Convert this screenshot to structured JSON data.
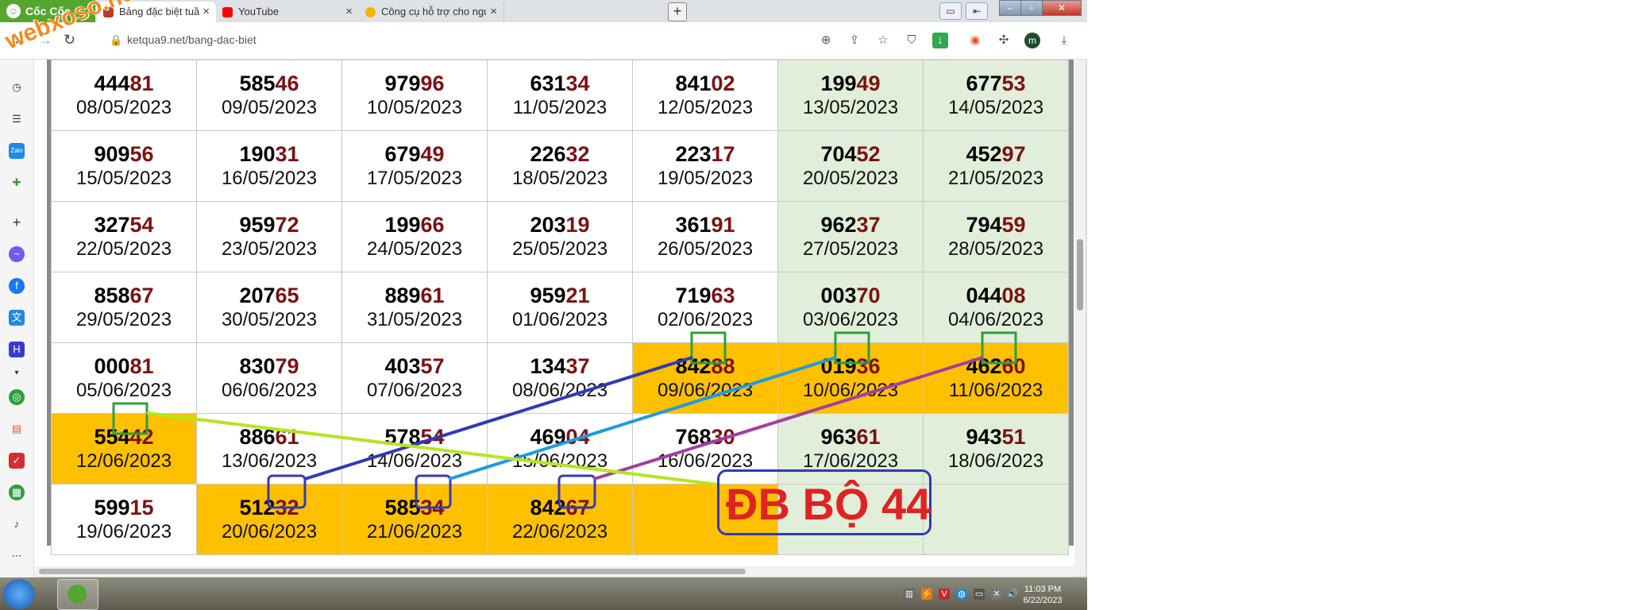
{
  "browser": {
    "brand": "Cốc Cốc",
    "tabs": [
      {
        "title": "Bảng đặc biệt tuần Xổ Số Tru",
        "favicon_color": "#c0392b",
        "active": true
      },
      {
        "title": "YouTube",
        "favicon_color": "#ff0000",
        "active": false
      },
      {
        "title": "Công cụ hỗ trợ cho người ch",
        "favicon_color": "#f4b400",
        "active": false
      }
    ],
    "url": "ketqua9.net/bang-dac-biet",
    "profile_initial": "m"
  },
  "watermark": "webxoso.net",
  "table": {
    "rows": [
      [
        {
          "pre": "444",
          "hi": "81",
          "date": "08/05/2023",
          "bg": "white"
        },
        {
          "pre": "585",
          "hi": "46",
          "date": "09/05/2023",
          "bg": "white"
        },
        {
          "pre": "979",
          "hi": "96",
          "date": "10/05/2023",
          "bg": "white"
        },
        {
          "pre": "631",
          "hi": "34",
          "date": "11/05/2023",
          "bg": "white"
        },
        {
          "pre": "841",
          "hi": "02",
          "date": "12/05/2023",
          "bg": "white"
        },
        {
          "pre": "199",
          "hi": "49",
          "date": "13/05/2023",
          "bg": "weekend"
        },
        {
          "pre": "677",
          "hi": "53",
          "date": "14/05/2023",
          "bg": "weekend"
        }
      ],
      [
        {
          "pre": "909",
          "hi": "56",
          "date": "15/05/2023",
          "bg": "white"
        },
        {
          "pre": "190",
          "hi": "31",
          "date": "16/05/2023",
          "bg": "white"
        },
        {
          "pre": "679",
          "hi": "49",
          "date": "17/05/2023",
          "bg": "white"
        },
        {
          "pre": "226",
          "hi": "32",
          "date": "18/05/2023",
          "bg": "white"
        },
        {
          "pre": "223",
          "hi": "17",
          "date": "19/05/2023",
          "bg": "white"
        },
        {
          "pre": "704",
          "hi": "52",
          "date": "20/05/2023",
          "bg": "weekend"
        },
        {
          "pre": "452",
          "hi": "97",
          "date": "21/05/2023",
          "bg": "weekend"
        }
      ],
      [
        {
          "pre": "327",
          "hi": "54",
          "date": "22/05/2023",
          "bg": "white"
        },
        {
          "pre": "959",
          "hi": "72",
          "date": "23/05/2023",
          "bg": "white"
        },
        {
          "pre": "199",
          "hi": "66",
          "date": "24/05/2023",
          "bg": "white"
        },
        {
          "pre": "203",
          "hi": "19",
          "date": "25/05/2023",
          "bg": "white"
        },
        {
          "pre": "361",
          "hi": "91",
          "date": "26/05/2023",
          "bg": "white"
        },
        {
          "pre": "962",
          "hi": "37",
          "date": "27/05/2023",
          "bg": "weekend"
        },
        {
          "pre": "794",
          "hi": "59",
          "date": "28/05/2023",
          "bg": "weekend"
        }
      ],
      [
        {
          "pre": "858",
          "hi": "67",
          "date": "29/05/2023",
          "bg": "white"
        },
        {
          "pre": "207",
          "hi": "65",
          "date": "30/05/2023",
          "bg": "white"
        },
        {
          "pre": "889",
          "hi": "61",
          "date": "31/05/2023",
          "bg": "white"
        },
        {
          "pre": "959",
          "hi": "21",
          "date": "01/06/2023",
          "bg": "white"
        },
        {
          "pre": "719",
          "hi": "63",
          "date": "02/06/2023",
          "bg": "white"
        },
        {
          "pre": "003",
          "hi": "70",
          "date": "03/06/2023",
          "bg": "weekend"
        },
        {
          "pre": "044",
          "hi": "08",
          "date": "04/06/2023",
          "bg": "weekend"
        }
      ],
      [
        {
          "pre": "000",
          "hi": "81",
          "date": "05/06/2023",
          "bg": "white"
        },
        {
          "pre": "830",
          "hi": "79",
          "date": "06/06/2023",
          "bg": "white"
        },
        {
          "pre": "403",
          "hi": "57",
          "date": "07/06/2023",
          "bg": "white"
        },
        {
          "pre": "134",
          "hi": "37",
          "date": "08/06/2023",
          "bg": "white"
        },
        {
          "pre": "842",
          "hi": "88",
          "date": "09/06/2023",
          "bg": "highlight"
        },
        {
          "pre": "019",
          "hi": "36",
          "date": "10/06/2023",
          "bg": "highlight"
        },
        {
          "pre": "462",
          "hi": "60",
          "date": "11/06/2023",
          "bg": "highlight"
        }
      ],
      [
        {
          "pre": "554",
          "hi": "42",
          "date": "12/06/2023",
          "bg": "highlight"
        },
        {
          "pre": "886",
          "hi": "61",
          "date": "13/06/2023",
          "bg": "white"
        },
        {
          "pre": "578",
          "hi": "54",
          "date": "14/06/2023",
          "bg": "white"
        },
        {
          "pre": "469",
          "hi": "04",
          "date": "15/06/2023",
          "bg": "white"
        },
        {
          "pre": "768",
          "hi": "30",
          "date": "16/06/2023",
          "bg": "white"
        },
        {
          "pre": "963",
          "hi": "61",
          "date": "17/06/2023",
          "bg": "weekend"
        },
        {
          "pre": "943",
          "hi": "51",
          "date": "18/06/2023",
          "bg": "weekend"
        }
      ],
      [
        {
          "pre": "599",
          "hi": "15",
          "date": "19/06/2023",
          "bg": "white"
        },
        {
          "pre": "512",
          "hi": "32",
          "date": "20/06/2023",
          "bg": "highlight"
        },
        {
          "pre": "585",
          "hi": "34",
          "date": "21/06/2023",
          "bg": "highlight"
        },
        {
          "pre": "842",
          "hi": "67",
          "date": "22/06/2023",
          "bg": "highlight"
        },
        {
          "pre": "",
          "hi": "",
          "date": "",
          "bg": "highlight"
        },
        {
          "pre": "",
          "hi": "",
          "date": "",
          "bg": "weekend"
        },
        {
          "pre": "",
          "hi": "",
          "date": "",
          "bg": "weekend"
        }
      ]
    ]
  },
  "annotation": {
    "label": "ĐB BỘ 44",
    "line_colors": [
      "#2f3bb5",
      "#1e9be0",
      "#a040a0",
      "#b5e61d"
    ],
    "box_colors": {
      "green": "#2e9e3e",
      "blue": "#3a3ab0"
    }
  },
  "taskbar": {
    "time": "11:03 PM",
    "date": "6/22/2023"
  },
  "colors": {
    "highlight": "#ffc000",
    "weekend": "#e1eed9",
    "number_accent": "#7b1212",
    "brand": "#55a630"
  }
}
